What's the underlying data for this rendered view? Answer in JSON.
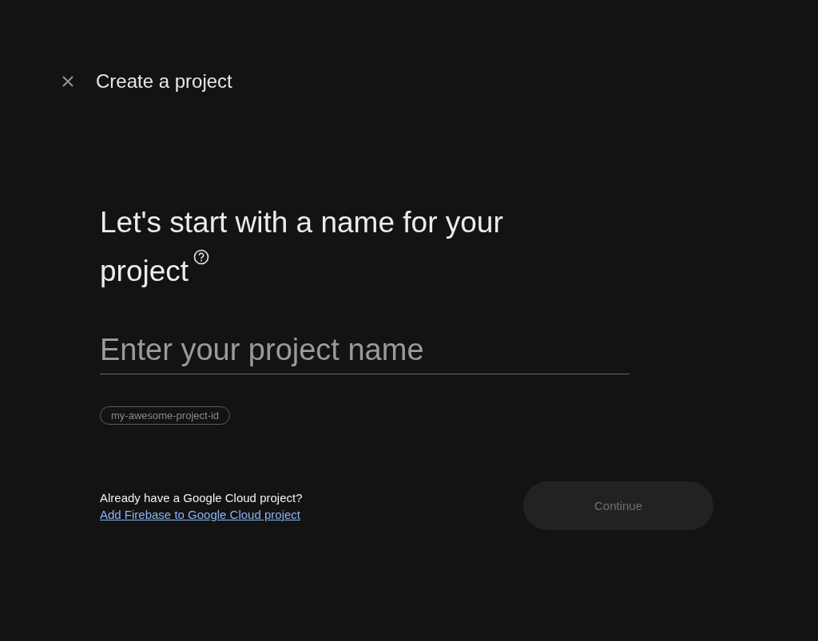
{
  "header": {
    "title": "Create a project"
  },
  "heading": "Let's start with a name for your project",
  "name_field": {
    "placeholder": "Enter your project name"
  },
  "project_id_chip": "my-awesome-project-id",
  "footer": {
    "question": "Already have a Google Cloud project?",
    "link": "Add Firebase to Google Cloud project",
    "continue_button": {
      "label": "Continue",
      "disabled": true
    }
  }
}
